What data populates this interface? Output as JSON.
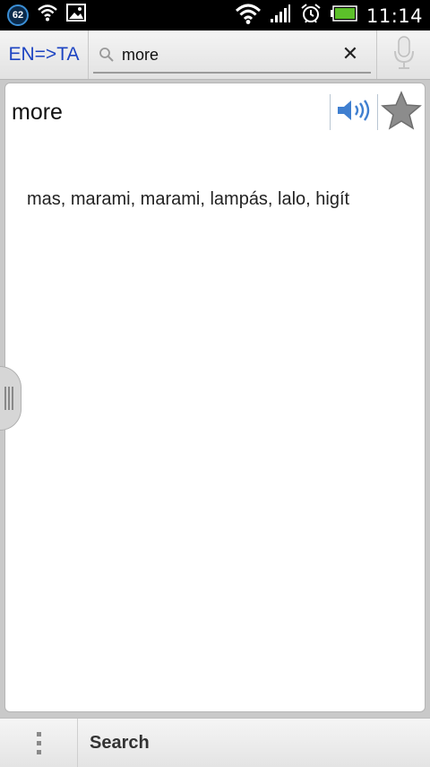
{
  "status_bar": {
    "notification_count": "62",
    "time": "11:14"
  },
  "toolbar": {
    "language_pair": "EN=>TA",
    "search_value": "more",
    "clear_label": "✕"
  },
  "entry": {
    "word": "more",
    "translation": "mas, marami, marami, lampás, lalo, higít"
  },
  "bottom_bar": {
    "search_label": "Search"
  },
  "colors": {
    "accent_blue": "#1d44c2",
    "battery_green": "#5cc02a",
    "speaker_blue": "#3f7fd0",
    "star_gray": "#8c8c8c"
  },
  "icons": [
    "notification-badge-icon",
    "wifi-icon",
    "image-icon",
    "signal-icon",
    "alarm-icon",
    "battery-icon",
    "search-icon",
    "microphone-icon",
    "speaker-icon",
    "star-icon",
    "menu-dots-icon",
    "drawer-handle-icon"
  ]
}
